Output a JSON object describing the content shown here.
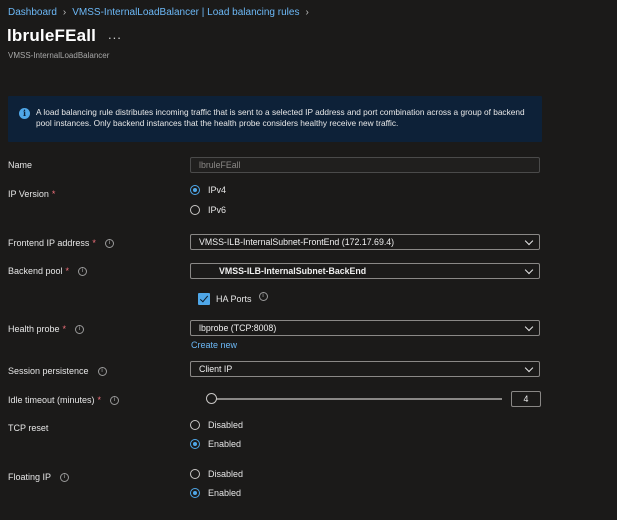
{
  "breadcrumb": {
    "items": [
      "Dashboard",
      "VMSS-InternalLoadBalancer | Load balancing rules"
    ]
  },
  "header": {
    "title": "lbruleFEall",
    "more": "...",
    "subtitle": "VMSS-InternalLoadBalancer"
  },
  "info": {
    "text": "A load balancing rule distributes incoming traffic that is sent to a selected IP address and port combination across a group of backend pool instances. Only backend instances that the health probe considers healthy receive new traffic."
  },
  "form": {
    "name": {
      "label": "Name",
      "value": "lbruleFEall"
    },
    "ip_version": {
      "label": "IP Version",
      "options": [
        "IPv4",
        "IPv6"
      ],
      "selected": "IPv4"
    },
    "frontend_ip": {
      "label": "Frontend IP address",
      "value": "VMSS-ILB-InternalSubnet-FrontEnd (172.17.69.4)"
    },
    "backend_pool": {
      "label": "Backend pool",
      "value": "VMSS-ILB-InternalSubnet-BackEnd"
    },
    "ha_ports": {
      "label": "HA Ports",
      "checked": true
    },
    "health_probe": {
      "label": "Health probe",
      "value": "lbprobe (TCP:8008)",
      "create_new": "Create new"
    },
    "session_persistence": {
      "label": "Session persistence",
      "value": "Client IP"
    },
    "idle_timeout": {
      "label": "Idle timeout (minutes)",
      "value": "4"
    },
    "tcp_reset": {
      "label": "TCP reset",
      "options": [
        "Disabled",
        "Enabled"
      ],
      "selected": "Enabled"
    },
    "floating_ip": {
      "label": "Floating IP",
      "options": [
        "Disabled",
        "Enabled"
      ],
      "selected": "Enabled"
    }
  },
  "colors": {
    "accent": "#4fa7e8",
    "link": "#6cb8f6",
    "required": "#f1707b",
    "background": "#1b1a19",
    "info_background": "#0d2138"
  }
}
